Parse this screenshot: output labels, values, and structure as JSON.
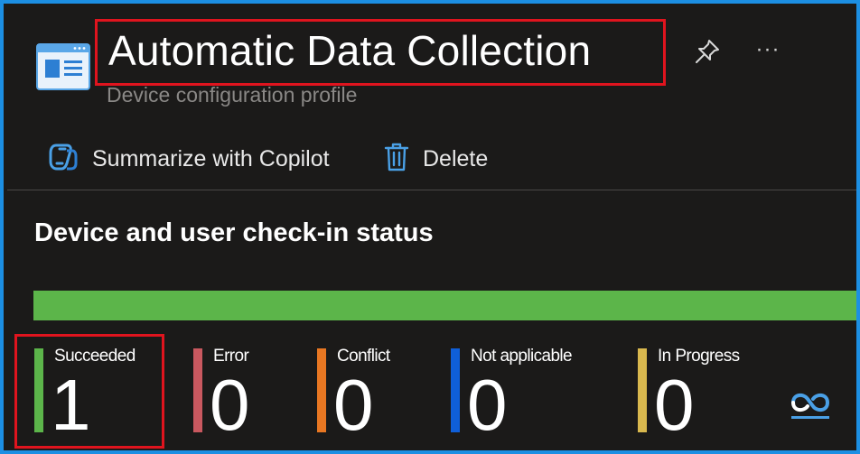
{
  "header": {
    "title": "Automatic Data Collection",
    "subtitle": "Device configuration profile",
    "icon": "profile-page-icon",
    "actions": {
      "pin_icon": "pin-icon",
      "more_label": "···"
    }
  },
  "toolbar": {
    "summarize_label": "Summarize with Copilot",
    "delete_label": "Delete"
  },
  "section": {
    "title": "Device and user check-in status"
  },
  "status_bar": {
    "succeeded_fraction": 1.0,
    "color": "#5cb54a"
  },
  "stats": [
    {
      "label": "Succeeded",
      "value": "1",
      "color": "#5cb54a"
    },
    {
      "label": "Error",
      "value": "0",
      "color": "#c9585f"
    },
    {
      "label": "Conflict",
      "value": "0",
      "color": "#e87722"
    },
    {
      "label": "Not applicable",
      "value": "0",
      "color": "#0f5fd9"
    },
    {
      "label": "In Progress",
      "value": "0",
      "color": "#d9b84e"
    }
  ],
  "colors": {
    "background": "#1b1a19",
    "frame_border": "#1c8fe3",
    "highlight": "#e0141e",
    "accent_blue": "#4aa0e6"
  }
}
